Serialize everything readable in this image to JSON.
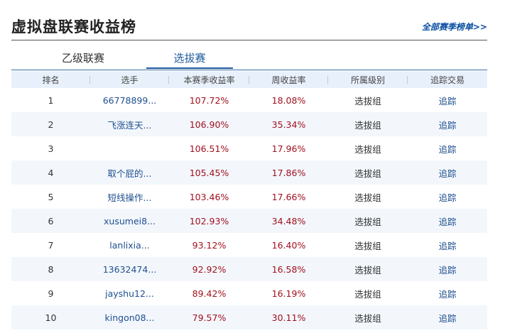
{
  "header": {
    "title": "虚拟盘联赛收益榜",
    "more_link": "全部赛季榜单>>"
  },
  "tabs": [
    {
      "label": "乙级联赛"
    },
    {
      "label": "选拔赛"
    }
  ],
  "table": {
    "columns": [
      "排名",
      "选手",
      "本赛季收益率",
      "周收益率",
      "所属级别",
      "追踪交易"
    ],
    "rows": [
      {
        "rank": "1",
        "player": "66778899...",
        "season_return": "107.72%",
        "weekly_return": "18.08%",
        "level": "选拔组",
        "track": "追踪"
      },
      {
        "rank": "2",
        "player": "飞涨连天...",
        "season_return": "106.90%",
        "weekly_return": "35.34%",
        "level": "选拔组",
        "track": "追踪"
      },
      {
        "rank": "3",
        "player": "",
        "season_return": "106.51%",
        "weekly_return": "17.96%",
        "level": "选拔组",
        "track": "追踪"
      },
      {
        "rank": "4",
        "player": "取个屁的...",
        "season_return": "105.45%",
        "weekly_return": "17.86%",
        "level": "选拔组",
        "track": "追踪"
      },
      {
        "rank": "5",
        "player": "短线操作...",
        "season_return": "103.46%",
        "weekly_return": "17.66%",
        "level": "选拔组",
        "track": "追踪"
      },
      {
        "rank": "6",
        "player": "xusumei8...",
        "season_return": "102.93%",
        "weekly_return": "34.48%",
        "level": "选拔组",
        "track": "追踪"
      },
      {
        "rank": "7",
        "player": "lanlixia...",
        "season_return": "93.12%",
        "weekly_return": "16.40%",
        "level": "选拔组",
        "track": "追踪"
      },
      {
        "rank": "8",
        "player": "13632474...",
        "season_return": "92.92%",
        "weekly_return": "16.58%",
        "level": "选拔组",
        "track": "追踪"
      },
      {
        "rank": "9",
        "player": "jayshu12...",
        "season_return": "89.42%",
        "weekly_return": "16.19%",
        "level": "选拔组",
        "track": "追踪"
      },
      {
        "rank": "10",
        "player": "kingon08...",
        "season_return": "79.57%",
        "weekly_return": "30.11%",
        "level": "选拔组",
        "track": "追踪"
      }
    ]
  },
  "colors": {
    "accent": "#1e5a9c",
    "return_red": "#a0101e",
    "header_bg": "#e8f1fb",
    "stripe_bg": "#f3f7fc"
  }
}
